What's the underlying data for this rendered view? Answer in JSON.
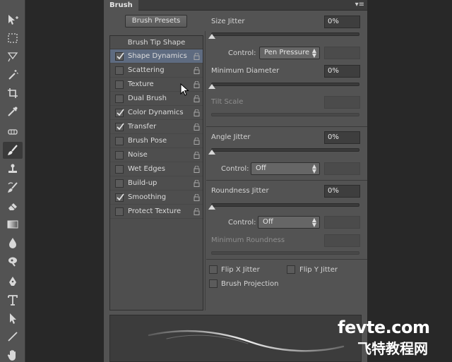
{
  "panel": {
    "tab_label": "Brush",
    "menu_glyph": "▾≡",
    "brush_presets_label": "Brush Presets",
    "list_header": "Brush Tip Shape",
    "items": [
      {
        "label": "Shape Dynamics",
        "checked": true,
        "selected": true
      },
      {
        "label": "Scattering",
        "checked": false,
        "selected": false
      },
      {
        "label": "Texture",
        "checked": false,
        "selected": false
      },
      {
        "label": "Dual Brush",
        "checked": false,
        "selected": false
      },
      {
        "label": "Color Dynamics",
        "checked": true,
        "selected": false
      },
      {
        "label": "Transfer",
        "checked": true,
        "selected": false
      },
      {
        "label": "Brush Pose",
        "checked": false,
        "selected": false
      },
      {
        "label": "Noise",
        "checked": false,
        "selected": false
      },
      {
        "label": "Wet Edges",
        "checked": false,
        "selected": false
      },
      {
        "label": "Build-up",
        "checked": false,
        "selected": false
      },
      {
        "label": "Smoothing",
        "checked": true,
        "selected": false
      },
      {
        "label": "Protect Texture",
        "checked": false,
        "selected": false
      }
    ]
  },
  "settings": {
    "size_jitter": {
      "label": "Size Jitter",
      "value": "0%"
    },
    "control_1": {
      "label": "Control:",
      "value": "Pen Pressure"
    },
    "minimum_diameter": {
      "label": "Minimum Diameter",
      "value": "0%"
    },
    "tilt_scale": {
      "label": "Tilt Scale"
    },
    "angle_jitter": {
      "label": "Angle Jitter",
      "value": "0%"
    },
    "control_2": {
      "label": "Control:",
      "value": "Off"
    },
    "roundness_jitter": {
      "label": "Roundness Jitter",
      "value": "0%"
    },
    "control_3": {
      "label": "Control:",
      "value": "Off"
    },
    "minimum_roundness": {
      "label": "Minimum Roundness"
    },
    "flip_x": {
      "label": "Flip X Jitter"
    },
    "flip_y": {
      "label": "Flip Y Jitter"
    },
    "brush_projection": {
      "label": "Brush Projection"
    }
  },
  "watermark": {
    "line1": "fevte.com",
    "line2": "飞特教程网"
  },
  "colors": {
    "panel_bg": "#535353",
    "selected_row": "#5e6b80",
    "field_bg": "#3e3e3e"
  },
  "tools": [
    "move-icon",
    "marquee-icon",
    "lasso-icon",
    "magic-wand-icon",
    "crop-icon",
    "eyedropper-icon",
    "healing-icon",
    "brush-icon",
    "stamp-icon",
    "history-brush-icon",
    "eraser-icon",
    "gradient-icon",
    "blur-icon",
    "dodge-icon",
    "pen-icon",
    "type-icon",
    "path-select-icon",
    "line-icon",
    "hand-icon"
  ]
}
